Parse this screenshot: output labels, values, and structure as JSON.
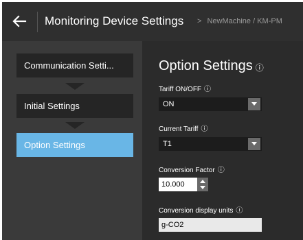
{
  "header": {
    "back_icon": "arrow-left-icon",
    "title": "Monitoring Device Settings",
    "breadcrumb_chevron": ">",
    "breadcrumb": "NewMachine / KM-PM"
  },
  "steps": [
    {
      "label": "Communication Setti..."
    },
    {
      "label": "Initial Settings"
    },
    {
      "label": "Option Settings",
      "active": true
    }
  ],
  "main": {
    "title": "Option Settings",
    "info_icon": "ⓘ",
    "fields": {
      "tariff_onoff": {
        "label": "Tariff ON/OFF",
        "value": "ON"
      },
      "current_tariff": {
        "label": "Current Tariff",
        "value": "T1"
      },
      "conversion_factor": {
        "label": "Conversion Factor",
        "value": "10.000"
      },
      "conversion_units": {
        "label": "Conversion display units",
        "value": "g-CO2"
      }
    }
  },
  "colors": {
    "active_step": "#69b6e6",
    "pane_background": "#2b2b2b",
    "header_background": "#2f2f2f"
  }
}
